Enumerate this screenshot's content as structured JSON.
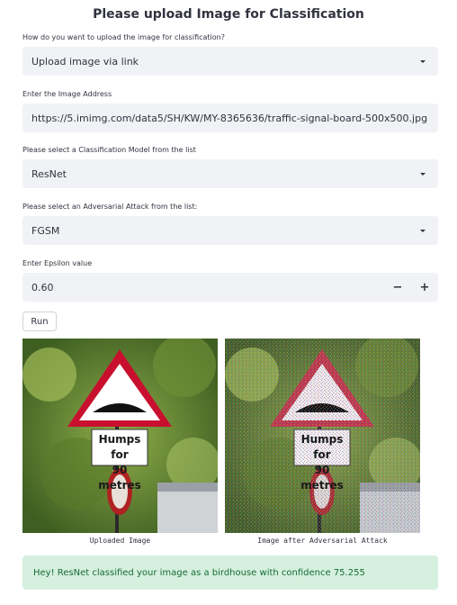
{
  "page_title": "Please upload Image for Classification",
  "upload_method": {
    "label": "How do you want to upload the image for classification?",
    "value": "Upload image via link"
  },
  "image_address": {
    "label": "Enter the Image Address",
    "value": "https://5.imimg.com/data5/SH/KW/MY-8365636/traffic-signal-board-500x500.jpg"
  },
  "model": {
    "label": "Please select a Classification Model from the list",
    "value": "ResNet"
  },
  "attack": {
    "label": "Please select an Adversarial Attack from the list:",
    "value": "FGSM"
  },
  "epsilon": {
    "label": "Enter Epsilon value",
    "value": "0.60",
    "minus": "−",
    "plus": "+"
  },
  "run_label": "Run",
  "images": {
    "sign_line1": "Humps for",
    "sign_line2": "90 metres",
    "uploaded_caption": "Uploaded Image",
    "adversarial_caption": "Image after Adversarial Attack"
  },
  "result": "Hey! ResNet classified your image as a birdhouse with confidence 75.255",
  "colors": {
    "field_bg": "#f0f2f6",
    "success_bg": "#d5f0de",
    "success_text": "#176b35",
    "sign_red": "#c8102e"
  }
}
